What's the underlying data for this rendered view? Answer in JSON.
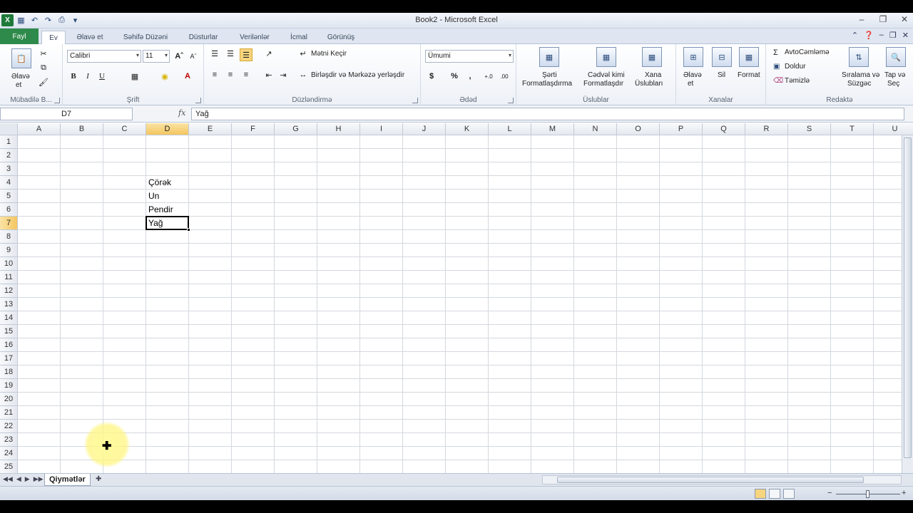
{
  "window": {
    "title": "Book2 - Microsoft Excel"
  },
  "tabs": [
    {
      "label": "Fayl"
    },
    {
      "label": "Ev"
    },
    {
      "label": "Əlavə et"
    },
    {
      "label": "Səhifə Düzəni"
    },
    {
      "label": "Düsturlar"
    },
    {
      "label": "Verilənlər"
    },
    {
      "label": "İcmal"
    },
    {
      "label": "Görünüş"
    }
  ],
  "ribbon": {
    "clipboard": {
      "label": "Mübadilə B...",
      "paste_l1": "Əlavə",
      "paste_l2": "et"
    },
    "font": {
      "label": "Şrift",
      "name": "Calibri",
      "size": "11",
      "bold": "B",
      "italic": "I",
      "underline": "U"
    },
    "alignment": {
      "label": "Düzləndirmə",
      "wrap": "Mətni Keçir",
      "merge": "Birləşdir və Mərkəzə yerləşdir"
    },
    "number": {
      "label": "Ədəd",
      "format": "Ümumi",
      "currency": "$",
      "percent": "%",
      "comma": ","
    },
    "styles": {
      "label": "Üslublar",
      "cond_l1": "Şərti",
      "cond_l2": "Formatlaşdırma",
      "table_l1": "Cədvəl kimi",
      "table_l2": "Formatlaşdır",
      "cell_l1": "Xana",
      "cell_l2": "Üslubları"
    },
    "cells": {
      "label": "Xanalar",
      "insert_l1": "Əlavə",
      "insert_l2": "et",
      "delete": "Sil",
      "format": "Format"
    },
    "editing": {
      "label": "Redaktə",
      "autosum": "AvtoCəmləmə",
      "fill": "Doldur",
      "clear": "Təmizlə",
      "sort_l1": "Sıralama və",
      "sort_l2": "Süzgəc",
      "find_l1": "Tap və",
      "find_l2": "Seç"
    }
  },
  "formula_bar": {
    "name_box": "D7",
    "fx": "fx",
    "value": "Yağ"
  },
  "columns": [
    "A",
    "B",
    "C",
    "D",
    "E",
    "F",
    "G",
    "H",
    "I",
    "J",
    "K",
    "L",
    "M",
    "N",
    "O",
    "P",
    "Q",
    "R",
    "S",
    "T",
    "U"
  ],
  "selected_column": "D",
  "rows": [
    "1",
    "2",
    "3",
    "4",
    "5",
    "6",
    "7",
    "8",
    "9",
    "10",
    "11",
    "12",
    "13",
    "14",
    "15",
    "16",
    "17",
    "18",
    "19",
    "20",
    "21",
    "22",
    "23",
    "24",
    "25"
  ],
  "selected_row": "7",
  "cells": [
    {
      "ref": "D4",
      "value": "Çörək"
    },
    {
      "ref": "D5",
      "value": "Un"
    },
    {
      "ref": "D6",
      "value": "Pendir"
    },
    {
      "ref": "D7",
      "value": "Yağ"
    }
  ],
  "active_cell": "D7",
  "sheets": [
    {
      "name": "Qiymətlər",
      "active": true
    }
  ],
  "icons": [
    "excel-logo-icon",
    "save-icon",
    "undo-icon",
    "redo-icon",
    "paste-icon",
    "cut-icon",
    "copy-icon",
    "format-painter-icon",
    "sum-icon",
    "sort-icon",
    "find-icon",
    "help-icon"
  ]
}
